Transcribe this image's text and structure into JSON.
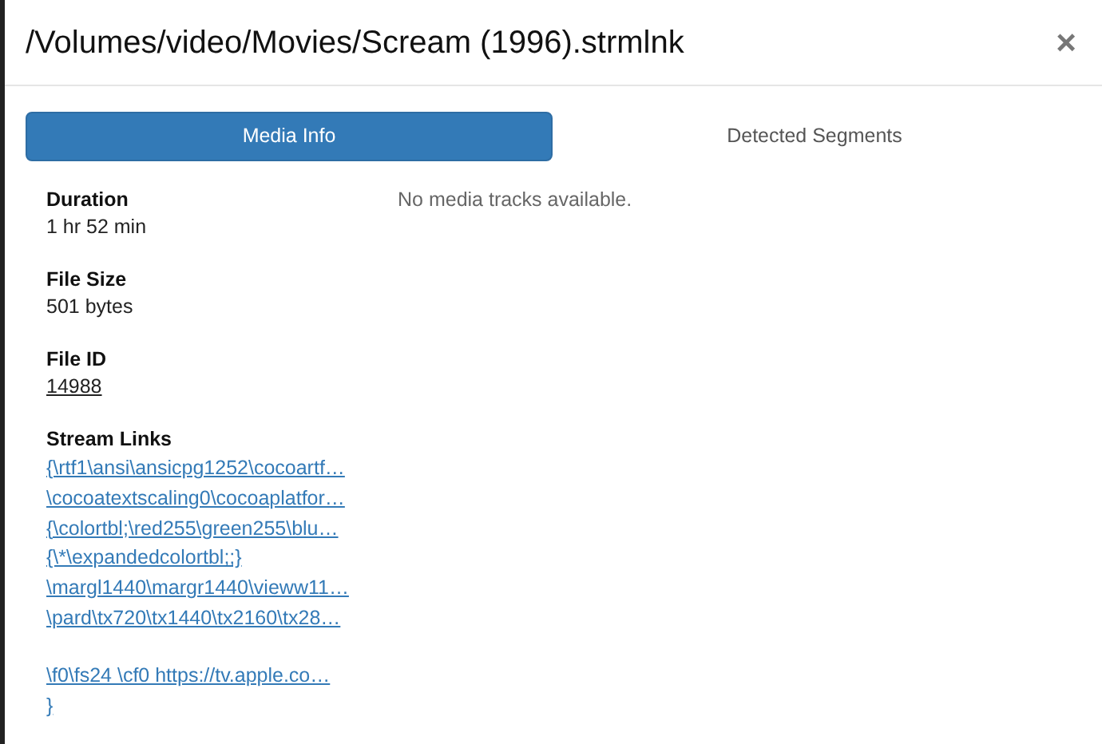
{
  "dialog": {
    "title": "/Volumes/video/Movies/Scream (1996).strmlnk",
    "close": "×"
  },
  "tabs": [
    {
      "label": "Media Info",
      "selected": true
    },
    {
      "label": "Detected Segments",
      "selected": false
    }
  ],
  "details": [
    {
      "kind": "text",
      "label": "Duration",
      "value": "1 hr 52 min"
    },
    {
      "kind": "text",
      "label": "File Size",
      "value": "501 bytes"
    },
    {
      "kind": "link",
      "label": "File ID",
      "value": "14988"
    }
  ],
  "stream_links": {
    "label": "Stream Links",
    "blocks": [
      [
        "{\\rtf1\\ansi\\ansicpg1252\\cocoartf…",
        "\\cocoatextscaling0\\cocoaplatfor…",
        "{\\colortbl;\\red255\\green255\\blu…",
        "{\\*\\expandedcolortbl;;}",
        "\\margl1440\\margr1440\\vieww11…",
        "\\pard\\tx720\\tx1440\\tx2160\\tx28…"
      ],
      [
        "\\f0\\fs24 \\cf0 https://tv.apple.co…",
        "}"
      ]
    ]
  },
  "tracks_message": "No media tracks available."
}
